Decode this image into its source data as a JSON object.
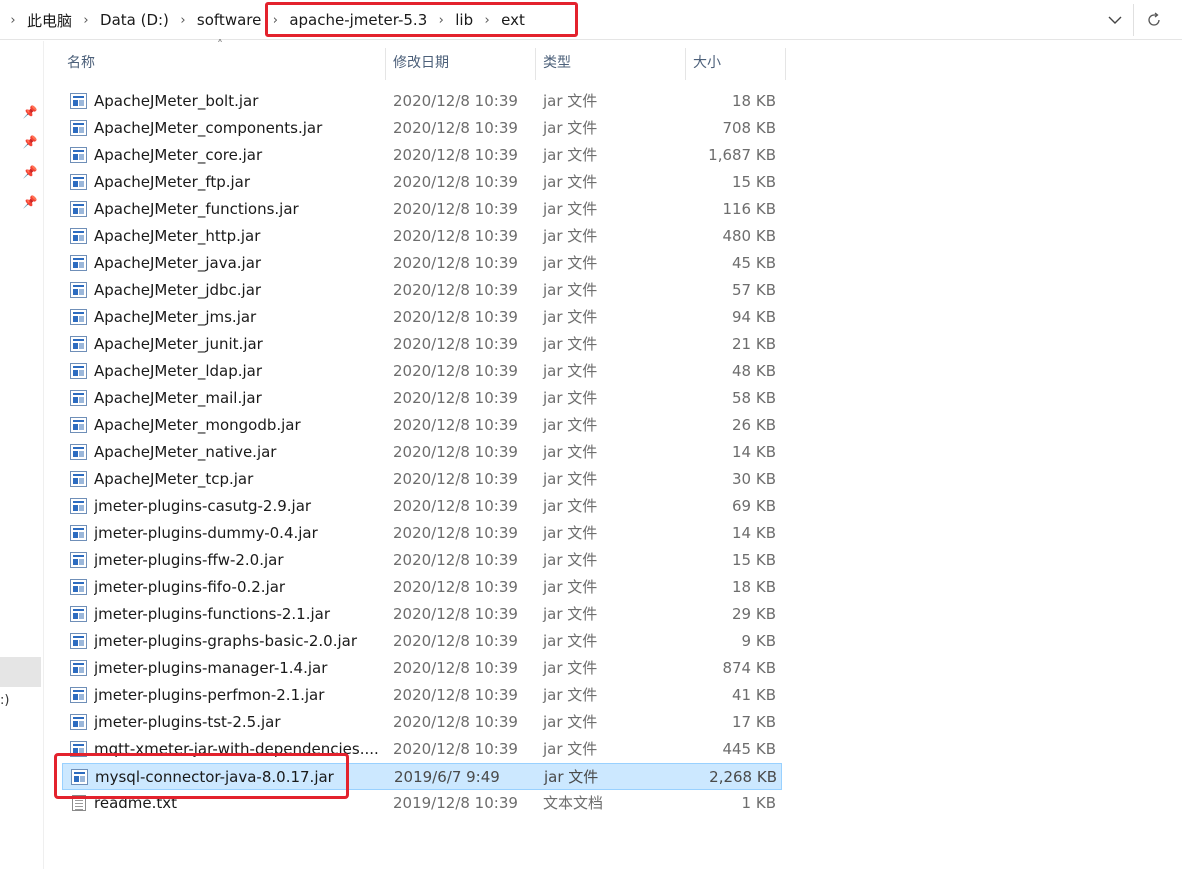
{
  "address_bar": {
    "breadcrumbs": [
      "此电脑",
      "Data (D:)",
      "software",
      "apache-jmeter-5.3",
      "lib",
      "ext"
    ]
  },
  "columns": {
    "name": "名称",
    "modified": "修改日期",
    "type": "类型",
    "size": "大小"
  },
  "files": [
    {
      "name": "ApacheJMeter_bolt.jar",
      "modified": "2020/12/8 10:39",
      "type": "jar 文件",
      "size": "18 KB",
      "icon": "jar-file-icon"
    },
    {
      "name": "ApacheJMeter_components.jar",
      "modified": "2020/12/8 10:39",
      "type": "jar 文件",
      "size": "708 KB",
      "icon": "jar-file-icon"
    },
    {
      "name": "ApacheJMeter_core.jar",
      "modified": "2020/12/8 10:39",
      "type": "jar 文件",
      "size": "1,687 KB",
      "icon": "jar-file-icon"
    },
    {
      "name": "ApacheJMeter_ftp.jar",
      "modified": "2020/12/8 10:39",
      "type": "jar 文件",
      "size": "15 KB",
      "icon": "jar-file-icon"
    },
    {
      "name": "ApacheJMeter_functions.jar",
      "modified": "2020/12/8 10:39",
      "type": "jar 文件",
      "size": "116 KB",
      "icon": "jar-file-icon"
    },
    {
      "name": "ApacheJMeter_http.jar",
      "modified": "2020/12/8 10:39",
      "type": "jar 文件",
      "size": "480 KB",
      "icon": "jar-file-icon"
    },
    {
      "name": "ApacheJMeter_java.jar",
      "modified": "2020/12/8 10:39",
      "type": "jar 文件",
      "size": "45 KB",
      "icon": "jar-file-icon"
    },
    {
      "name": "ApacheJMeter_jdbc.jar",
      "modified": "2020/12/8 10:39",
      "type": "jar 文件",
      "size": "57 KB",
      "icon": "jar-file-icon"
    },
    {
      "name": "ApacheJMeter_jms.jar",
      "modified": "2020/12/8 10:39",
      "type": "jar 文件",
      "size": "94 KB",
      "icon": "jar-file-icon"
    },
    {
      "name": "ApacheJMeter_junit.jar",
      "modified": "2020/12/8 10:39",
      "type": "jar 文件",
      "size": "21 KB",
      "icon": "jar-file-icon"
    },
    {
      "name": "ApacheJMeter_ldap.jar",
      "modified": "2020/12/8 10:39",
      "type": "jar 文件",
      "size": "48 KB",
      "icon": "jar-file-icon"
    },
    {
      "name": "ApacheJMeter_mail.jar",
      "modified": "2020/12/8 10:39",
      "type": "jar 文件",
      "size": "58 KB",
      "icon": "jar-file-icon"
    },
    {
      "name": "ApacheJMeter_mongodb.jar",
      "modified": "2020/12/8 10:39",
      "type": "jar 文件",
      "size": "26 KB",
      "icon": "jar-file-icon"
    },
    {
      "name": "ApacheJMeter_native.jar",
      "modified": "2020/12/8 10:39",
      "type": "jar 文件",
      "size": "14 KB",
      "icon": "jar-file-icon"
    },
    {
      "name": "ApacheJMeter_tcp.jar",
      "modified": "2020/12/8 10:39",
      "type": "jar 文件",
      "size": "30 KB",
      "icon": "jar-file-icon"
    },
    {
      "name": "jmeter-plugins-casutg-2.9.jar",
      "modified": "2020/12/8 10:39",
      "type": "jar 文件",
      "size": "69 KB",
      "icon": "jar-file-icon"
    },
    {
      "name": "jmeter-plugins-dummy-0.4.jar",
      "modified": "2020/12/8 10:39",
      "type": "jar 文件",
      "size": "14 KB",
      "icon": "jar-file-icon"
    },
    {
      "name": "jmeter-plugins-ffw-2.0.jar",
      "modified": "2020/12/8 10:39",
      "type": "jar 文件",
      "size": "15 KB",
      "icon": "jar-file-icon"
    },
    {
      "name": "jmeter-plugins-fifo-0.2.jar",
      "modified": "2020/12/8 10:39",
      "type": "jar 文件",
      "size": "18 KB",
      "icon": "jar-file-icon"
    },
    {
      "name": "jmeter-plugins-functions-2.1.jar",
      "modified": "2020/12/8 10:39",
      "type": "jar 文件",
      "size": "29 KB",
      "icon": "jar-file-icon"
    },
    {
      "name": "jmeter-plugins-graphs-basic-2.0.jar",
      "modified": "2020/12/8 10:39",
      "type": "jar 文件",
      "size": "9 KB",
      "icon": "jar-file-icon"
    },
    {
      "name": "jmeter-plugins-manager-1.4.jar",
      "modified": "2020/12/8 10:39",
      "type": "jar 文件",
      "size": "874 KB",
      "icon": "jar-file-icon"
    },
    {
      "name": "jmeter-plugins-perfmon-2.1.jar",
      "modified": "2020/12/8 10:39",
      "type": "jar 文件",
      "size": "41 KB",
      "icon": "jar-file-icon"
    },
    {
      "name": "jmeter-plugins-tst-2.5.jar",
      "modified": "2020/12/8 10:39",
      "type": "jar 文件",
      "size": "17 KB",
      "icon": "jar-file-icon"
    },
    {
      "name": "mqtt-xmeter-jar-with-dependencies....",
      "modified": "2020/12/8 10:39",
      "type": "jar 文件",
      "size": "445 KB",
      "icon": "jar-file-icon"
    },
    {
      "name": "mysql-connector-java-8.0.17.jar",
      "modified": "2019/6/7 9:49",
      "type": "jar 文件",
      "size": "2,268 KB",
      "icon": "jar-file-icon",
      "selected": true
    },
    {
      "name": "readme.txt",
      "modified": "2019/12/8 10:39",
      "type": "文本文档",
      "size": "1 KB",
      "icon": "text-file-icon"
    }
  ],
  "nav_pane": {
    "partial_label": ":)"
  },
  "colors": {
    "selection_bg": "#cce8ff",
    "selection_border": "#99d1ff",
    "annotation_red": "#e3222d",
    "header_text": "#4c607a"
  }
}
